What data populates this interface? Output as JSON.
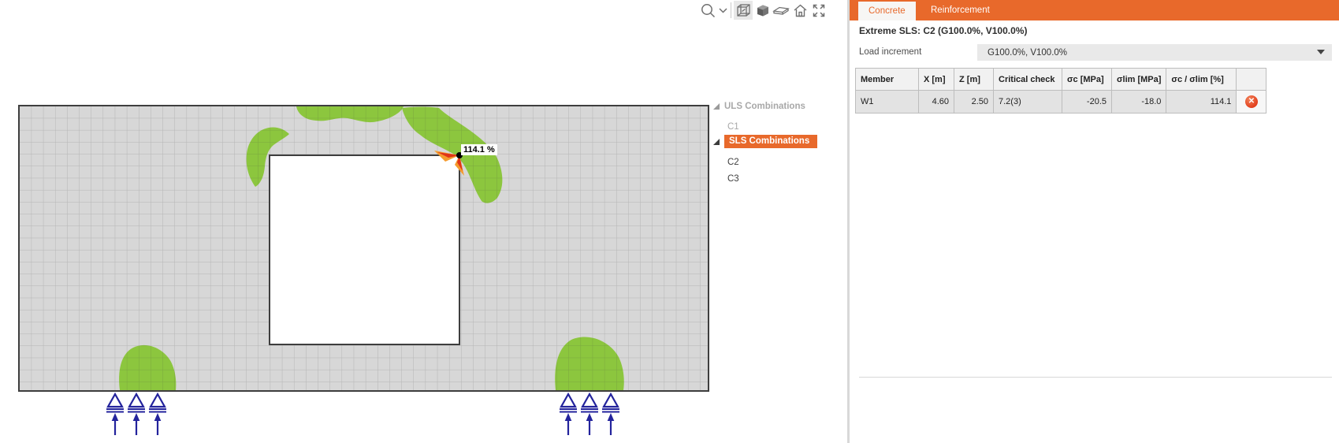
{
  "toolbar": {
    "icons": [
      "zoom",
      "zoom-options-dropdown",
      "wireframe-view",
      "solid-view",
      "slab-view",
      "home-view",
      "fit-to-screen"
    ]
  },
  "canvas": {
    "critical_point_label": "114.1 %"
  },
  "tree": {
    "items": [
      {
        "label": "ULS Combinations",
        "type": "group",
        "state": "dimmed"
      },
      {
        "label": "C1",
        "type": "item",
        "state": "dimmed"
      },
      {
        "label": "SLS Combinations",
        "type": "group",
        "state": "selected"
      },
      {
        "label": "C2",
        "type": "item",
        "state": "normal"
      },
      {
        "label": "C3",
        "type": "item",
        "state": "normal"
      }
    ]
  },
  "panel": {
    "tabs": [
      {
        "label": "Concrete",
        "active": true
      },
      {
        "label": "Reinforcement",
        "active": false
      }
    ],
    "extreme_title": "Extreme SLS: C2 (G100.0%, V100.0%)",
    "load_increment": {
      "label": "Load increment",
      "value": "G100.0%, V100.0%"
    },
    "results_table": {
      "headers": [
        "Member",
        "X [m]",
        "Z [m]",
        "Critical check",
        "σc [MPa]",
        "σlim [MPa]",
        "σc / σlim [%]",
        ""
      ],
      "rows": [
        {
          "member": "W1",
          "x": "4.60",
          "z": "2.50",
          "critical_check": "7.2(3)",
          "sigma_c": "-20.5",
          "sigma_lim": "-18.0",
          "ratio": "114.1",
          "status": "fail",
          "status_glyph": "✕"
        }
      ]
    }
  },
  "colors": {
    "accent_orange": "#e8692b",
    "check_green": "#8cc63e",
    "support_navy": "#23239c",
    "error_red": "#e2401e",
    "mesh_gray": "#d7d7d7"
  }
}
